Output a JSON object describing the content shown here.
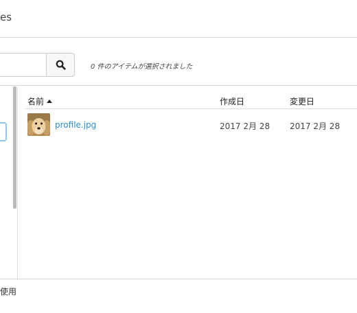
{
  "header": {
    "title": "es"
  },
  "toolbar": {
    "search_value": "",
    "search_icon": "search-icon",
    "selection_status": "0 件のアイテムが選択されました"
  },
  "table": {
    "columns": [
      "名前",
      "作成日",
      "変更日"
    ],
    "sort_column": "名前",
    "sort_direction": "ascending",
    "rows": [
      {
        "name": "profile.jpg",
        "thumbnail": "dog-photo",
        "created": "2017 2月 28",
        "modified": "2017 2月 28"
      }
    ]
  },
  "footer": {
    "text": "使用"
  },
  "colors": {
    "link": "#2a8bcf",
    "border": "#dcdcdc",
    "focus": "#8ec3ea"
  }
}
